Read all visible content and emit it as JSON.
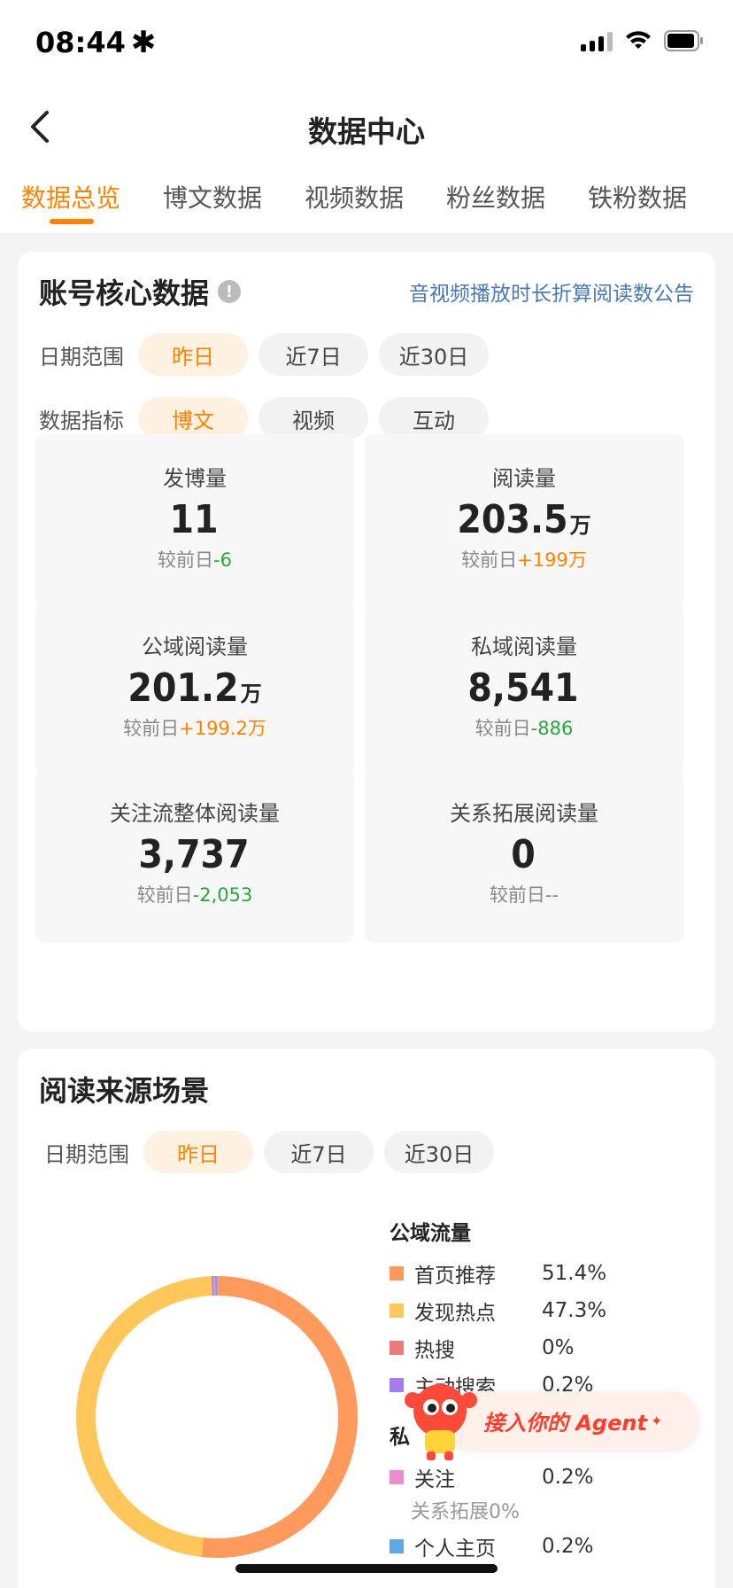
{
  "status": {
    "time": "08:44",
    "asterisk": "✱"
  },
  "nav": {
    "title": "数据中心"
  },
  "tabs": [
    {
      "label": "数据总览",
      "active": true
    },
    {
      "label": "博文数据",
      "active": false
    },
    {
      "label": "视频数据",
      "active": false
    },
    {
      "label": "粉丝数据",
      "active": false
    },
    {
      "label": "铁粉数据",
      "active": false
    }
  ],
  "core": {
    "title": "账号核心数据",
    "notice_link": "音视频播放时长折算阅读数公告",
    "date_filter": {
      "label": "日期范围",
      "options": [
        "昨日",
        "近7日",
        "近30日"
      ],
      "selected": "昨日"
    },
    "metric_filter": {
      "label": "数据指标",
      "options": [
        "博文",
        "视频",
        "互动"
      ],
      "selected": "博文"
    },
    "stats": [
      {
        "label": "发博量",
        "value": "11",
        "unit": "",
        "compare_prefix": "较前日",
        "delta": "-6",
        "trend": "down"
      },
      {
        "label": "阅读量",
        "value": "203.5",
        "unit": "万",
        "compare_prefix": "较前日",
        "delta": "+199万",
        "trend": "up"
      },
      {
        "label": "公域阅读量",
        "value": "201.2",
        "unit": "万",
        "compare_prefix": "较前日",
        "delta": "+199.2万",
        "trend": "up"
      },
      {
        "label": "私域阅读量",
        "value": "8,541",
        "unit": "",
        "compare_prefix": "较前日",
        "delta": "-886",
        "trend": "down"
      },
      {
        "label": "关注流整体阅读量",
        "value": "3,737",
        "unit": "",
        "compare_prefix": "较前日",
        "delta": "-2,053",
        "trend": "down"
      },
      {
        "label": "关系拓展阅读量",
        "value": "0",
        "unit": "",
        "compare_prefix": "较前日",
        "delta": "--",
        "trend": "flat"
      }
    ]
  },
  "source": {
    "title": "阅读来源场景",
    "date_filter": {
      "label": "日期范围",
      "options": [
        "昨日",
        "近7日",
        "近30日"
      ],
      "selected": "昨日"
    },
    "public_head": "公域流量",
    "private_head": "私",
    "public_items": [
      {
        "name": "首页推荐",
        "pct": "51.4%",
        "color": "#ff9a5c",
        "value": 51.4
      },
      {
        "name": "发现热点",
        "pct": "47.3%",
        "color": "#ffc75a",
        "value": 47.3
      },
      {
        "name": "热搜",
        "pct": "0%",
        "color": "#f07a7a",
        "value": 0
      },
      {
        "name": "主动搜索",
        "pct": "0.2%",
        "color": "#a57cf0",
        "value": 0.2
      }
    ],
    "private_items": [
      {
        "name": "关注",
        "pct": "0.2%",
        "color": "#f08ccc",
        "value": 0.2
      },
      {
        "name": "个人主页",
        "pct": "0.2%",
        "color": "#5fa8e0",
        "value": 0.2
      }
    ],
    "private_sub": "关系拓展0%"
  },
  "agent": {
    "label": "接入你的 Agent",
    "sparkle": "✦"
  }
}
